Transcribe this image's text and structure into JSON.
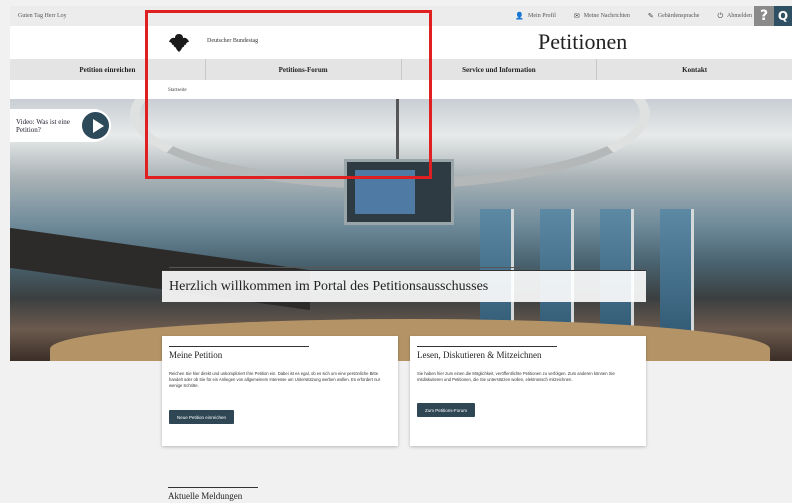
{
  "topbar": {
    "greeting": "Guten Tag Herr Loy",
    "links": [
      {
        "icon": "user-icon",
        "glyph": "👤",
        "label": "Mein Profil"
      },
      {
        "icon": "envelope-icon",
        "glyph": "✉",
        "label": "Meine Nachrichten"
      },
      {
        "icon": "notepad-icon",
        "glyph": "✎",
        "label": "Gebärdensprache"
      },
      {
        "icon": "logout-icon",
        "glyph": "⏻",
        "label": "Abmelden"
      }
    ],
    "help_glyph": "?",
    "search_glyph": "Q"
  },
  "header": {
    "org_name": "Deutscher Bundestag",
    "portal_title": "Petitionen"
  },
  "nav": {
    "items": [
      "Petition einreichen",
      "Petitions-Forum",
      "Service und Information",
      "Kontakt"
    ]
  },
  "breadcrumb": "Startseite",
  "hero": {
    "video_label": "Video: Was ist eine Petition?",
    "welcome": "Herzlich willkommen im Portal des Petitionsausschusses"
  },
  "cards": [
    {
      "title": "Meine Petition",
      "text": "Reichen Sie hier direkt und unkompliziert Ihre Petition ein. Dabei ist es egal, ob es sich um eine persönliche Bitte handelt oder ob Sie für ein Anliegen von allgemeinem Interesse um Unterstützung werben wollen. Es erfordert nur wenige Schritte.",
      "button": "Neue Petition einreichen"
    },
    {
      "title": "Lesen, Diskutieren & Mitzeichnen",
      "text": "Sie haben hier zum einen die Möglichkeit, veröffentlichte Petitionen zu verfolgen. Zum anderen können Sie mitdiskutieren und Petitionen, die Sie unterstützen wollen, elektronisch mitzeichnen.",
      "button": "Zum Petitions-Forum"
    }
  ],
  "news_title": "Aktuelle Meldungen",
  "colors": {
    "highlight": "#e02020",
    "primary_button": "#2f4654",
    "search_button": "#2f5062"
  }
}
